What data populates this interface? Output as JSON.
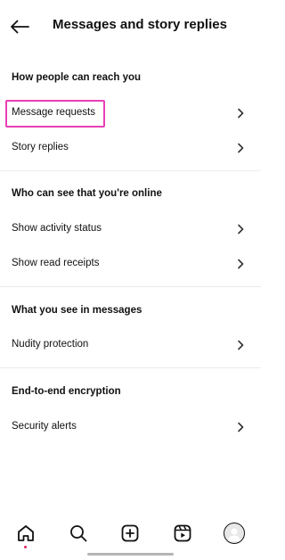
{
  "header": {
    "title": "Messages and story replies",
    "back_icon": "back-arrow-icon"
  },
  "sections": [
    {
      "heading": "How people can reach you",
      "items": [
        {
          "label": "Message requests",
          "highlighted": true
        },
        {
          "label": "Story replies"
        }
      ]
    },
    {
      "heading": "Who can see that you're online",
      "items": [
        {
          "label": "Show activity status"
        },
        {
          "label": "Show read receipts"
        }
      ]
    },
    {
      "heading": "What you see in messages",
      "items": [
        {
          "label": "Nudity protection"
        }
      ]
    },
    {
      "heading": "End-to-end encryption",
      "items": [
        {
          "label": "Security alerts"
        }
      ]
    }
  ],
  "bottom_nav": {
    "items": [
      "home-icon",
      "search-icon",
      "create-icon",
      "reels-icon",
      "profile-avatar"
    ],
    "active": "home-icon"
  },
  "colors": {
    "highlight": "#e83fb5",
    "active_dot": "#e0245e",
    "text": "#111111",
    "divider": "#ececec"
  }
}
